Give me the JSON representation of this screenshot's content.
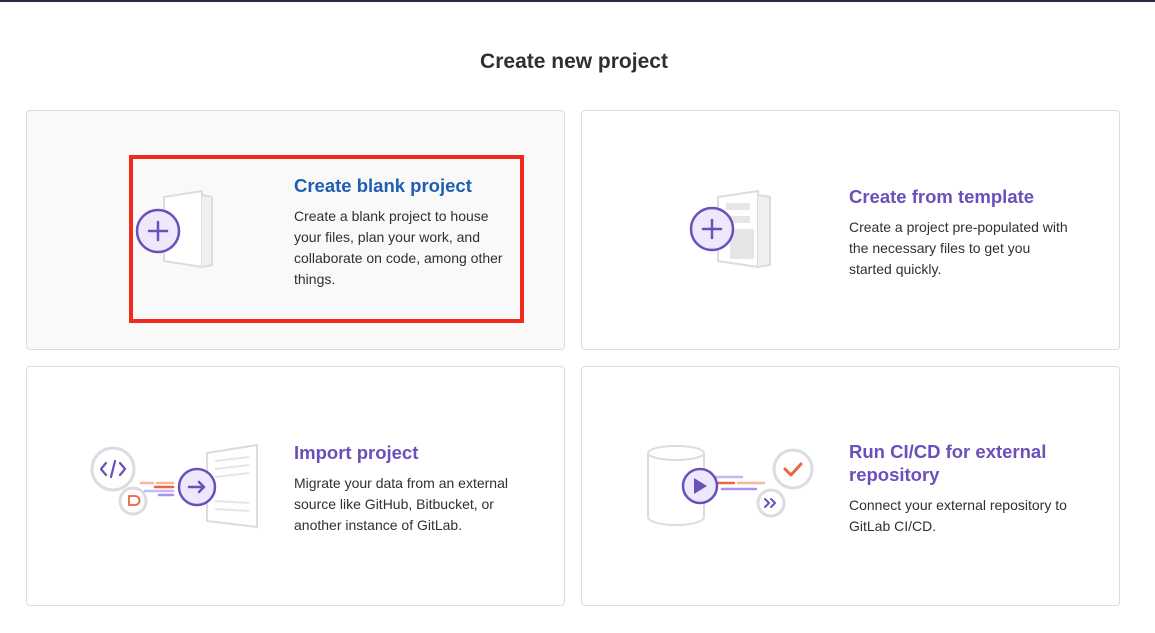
{
  "page": {
    "title": "Create new project"
  },
  "cards": [
    {
      "title": "Create blank project",
      "description": "Create a blank project to house your files, plan your work, and collaborate on code, among other things.",
      "icon": "blank-project-illustration"
    },
    {
      "title": "Create from template",
      "description": "Create a project pre-populated with the necessary files to get you started quickly.",
      "icon": "template-project-illustration"
    },
    {
      "title": "Import project",
      "description": "Migrate your data from an external source like GitHub, Bitbucket, or another instance of GitLab.",
      "icon": "import-project-illustration"
    },
    {
      "title": "Run CI/CD for external repository",
      "description": "Connect your external repository to GitLab CI/CD.",
      "icon": "cicd-project-illustration"
    }
  ],
  "colors": {
    "accent_purple": "#6b4fbb",
    "link_blue": "#1f5db4",
    "highlight_red": "#f02b1d",
    "orange": "#e9663e"
  }
}
